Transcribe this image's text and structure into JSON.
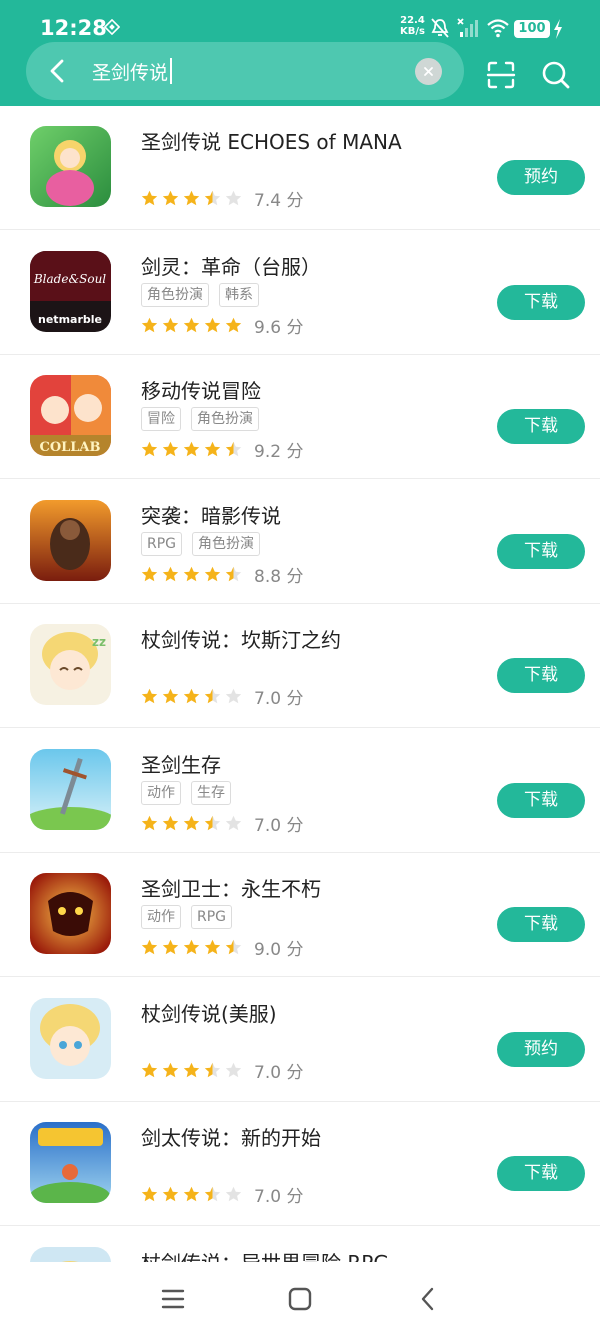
{
  "status_bar": {
    "time": "12:28",
    "net_speed_value": "22.4",
    "net_speed_unit": "KB/s",
    "battery": "100",
    "icons": [
      "sync-icon",
      "mute-icon",
      "signal-icon",
      "wifi-icon",
      "charging-icon"
    ]
  },
  "search": {
    "query": "圣剑传说"
  },
  "colors": {
    "accent": "#23b89a",
    "star_on": "#f5b31a",
    "star_off": "#e3e3e3"
  },
  "results": [
    {
      "name": "圣剑传说 ECHOES of MANA",
      "tags": [],
      "rating": 3.5,
      "score": "7.4 分",
      "action": "预约"
    },
    {
      "name": "剑灵：革命（台服）",
      "tags": [
        "角色扮演",
        "韩系"
      ],
      "rating": 5,
      "score": "9.6 分",
      "action": "下载"
    },
    {
      "name": "移动传说冒险",
      "tags": [
        "冒险",
        "角色扮演"
      ],
      "rating": 4.5,
      "score": "9.2 分",
      "action": "下载"
    },
    {
      "name": "突袭：暗影传说",
      "tags": [
        "RPG",
        "角色扮演"
      ],
      "rating": 4.5,
      "score": "8.8 分",
      "action": "下载"
    },
    {
      "name": "杖剑传说：坎斯汀之约",
      "tags": [],
      "rating": 3.5,
      "score": "7.0 分",
      "action": "下载"
    },
    {
      "name": "圣剑生存",
      "tags": [
        "动作",
        "生存"
      ],
      "rating": 3.5,
      "score": "7.0 分",
      "action": "下载"
    },
    {
      "name": "圣剑卫士：永生不朽",
      "tags": [
        "动作",
        "RPG"
      ],
      "rating": 4.5,
      "score": "9.0 分",
      "action": "下载"
    },
    {
      "name": "杖剑传说(美服)",
      "tags": [],
      "rating": 3.5,
      "score": "7.0 分",
      "action": "预约"
    },
    {
      "name": "剑太传说：新的开始",
      "tags": [],
      "rating": 3.5,
      "score": "7.0 分",
      "action": "下载"
    },
    {
      "name": "杖剑传说：异世界冒险 RPG",
      "tags": [],
      "rating": 0,
      "score": "",
      "action": ""
    }
  ]
}
